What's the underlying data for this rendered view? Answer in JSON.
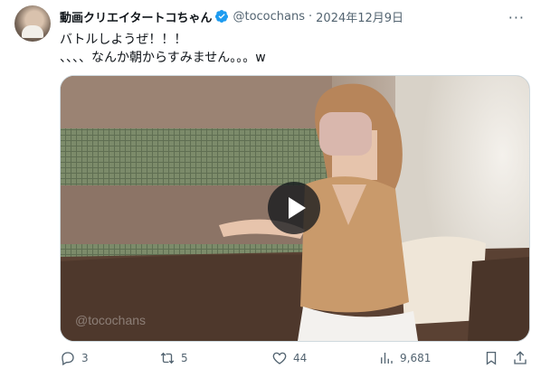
{
  "tweet": {
    "display_name": "動画クリエイタートコちゃん",
    "handle": "@tocochans",
    "separator": "·",
    "date": "2024年12月9日",
    "more_label": "···",
    "text_lines": [
      "バトルしようぜ！！！",
      "、、、、なんか朝からすみません。。。w"
    ],
    "media_watermark": "@tocochans"
  },
  "actions": {
    "replies": "3",
    "retweets": "5",
    "likes": "44",
    "views": "9,681"
  },
  "colors": {
    "text": "#0f1419",
    "muted": "#536471",
    "verified": "#1d9bf0"
  }
}
